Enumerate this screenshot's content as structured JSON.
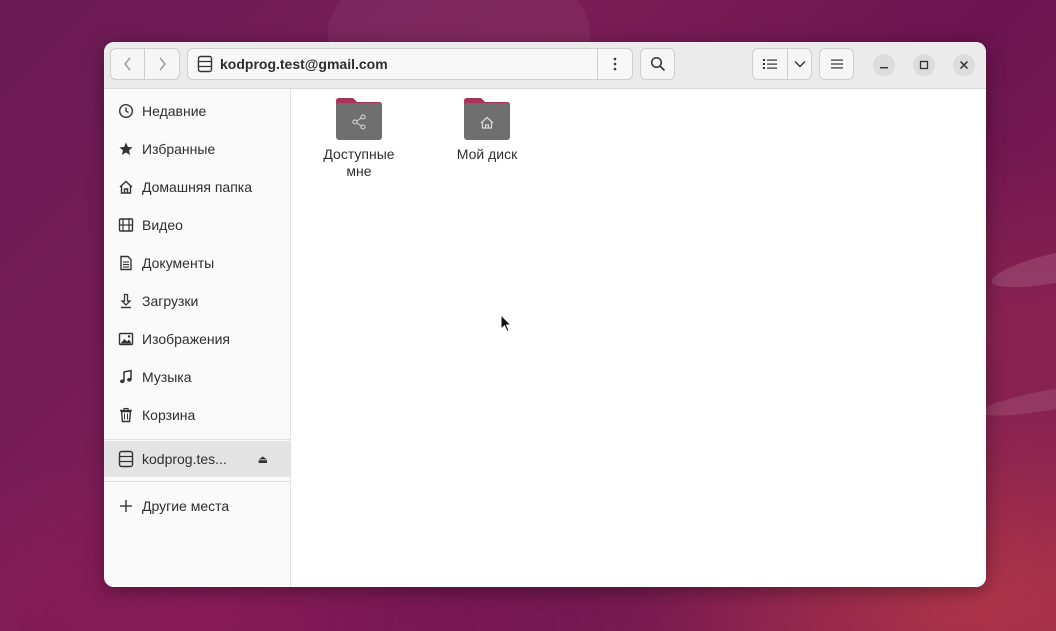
{
  "window": {
    "path_label": "kodprog.test@gmail.com",
    "path_icon": "drive-icon"
  },
  "header": {
    "back_icon": "chevron-left-icon",
    "forward_icon": "chevron-right-icon",
    "path_menu_icon": "vertical-dots-icon",
    "search_icon": "search-icon",
    "view_list_icon": "list-view-icon",
    "view_dropdown_icon": "chevron-down-icon",
    "menu_icon": "hamburger-icon",
    "minimize_icon": "minimize-icon",
    "maximize_icon": "maximize-icon",
    "close_icon": "close-icon"
  },
  "sidebar": {
    "items": [
      {
        "label": "Недавние",
        "icon": "clock-icon"
      },
      {
        "label": "Избранные",
        "icon": "star-icon"
      },
      {
        "label": "Домашняя папка",
        "icon": "home-icon"
      },
      {
        "label": "Видео",
        "icon": "film-icon"
      },
      {
        "label": "Документы",
        "icon": "document-icon"
      },
      {
        "label": "Загрузки",
        "icon": "download-icon"
      },
      {
        "label": "Изображения",
        "icon": "image-icon"
      },
      {
        "label": "Музыка",
        "icon": "music-icon"
      },
      {
        "label": "Корзина",
        "icon": "trash-icon"
      }
    ],
    "mount": {
      "label": "kodprog.tes...",
      "icon": "drive-icon",
      "eject_icon": "eject-icon"
    },
    "other": {
      "label": "Другие места",
      "icon": "plus-icon"
    }
  },
  "content": {
    "folders": [
      {
        "label_line1": "Доступные",
        "label_line2": "мне",
        "icon": "shared-folder-icon"
      },
      {
        "label_line1": "Мой диск",
        "label_line2": "",
        "icon": "home-folder-icon"
      }
    ]
  },
  "colors": {
    "folder_body": "#6f6f6f",
    "folder_tab": "#a8345a",
    "selected_row": "#e4e4e4"
  }
}
